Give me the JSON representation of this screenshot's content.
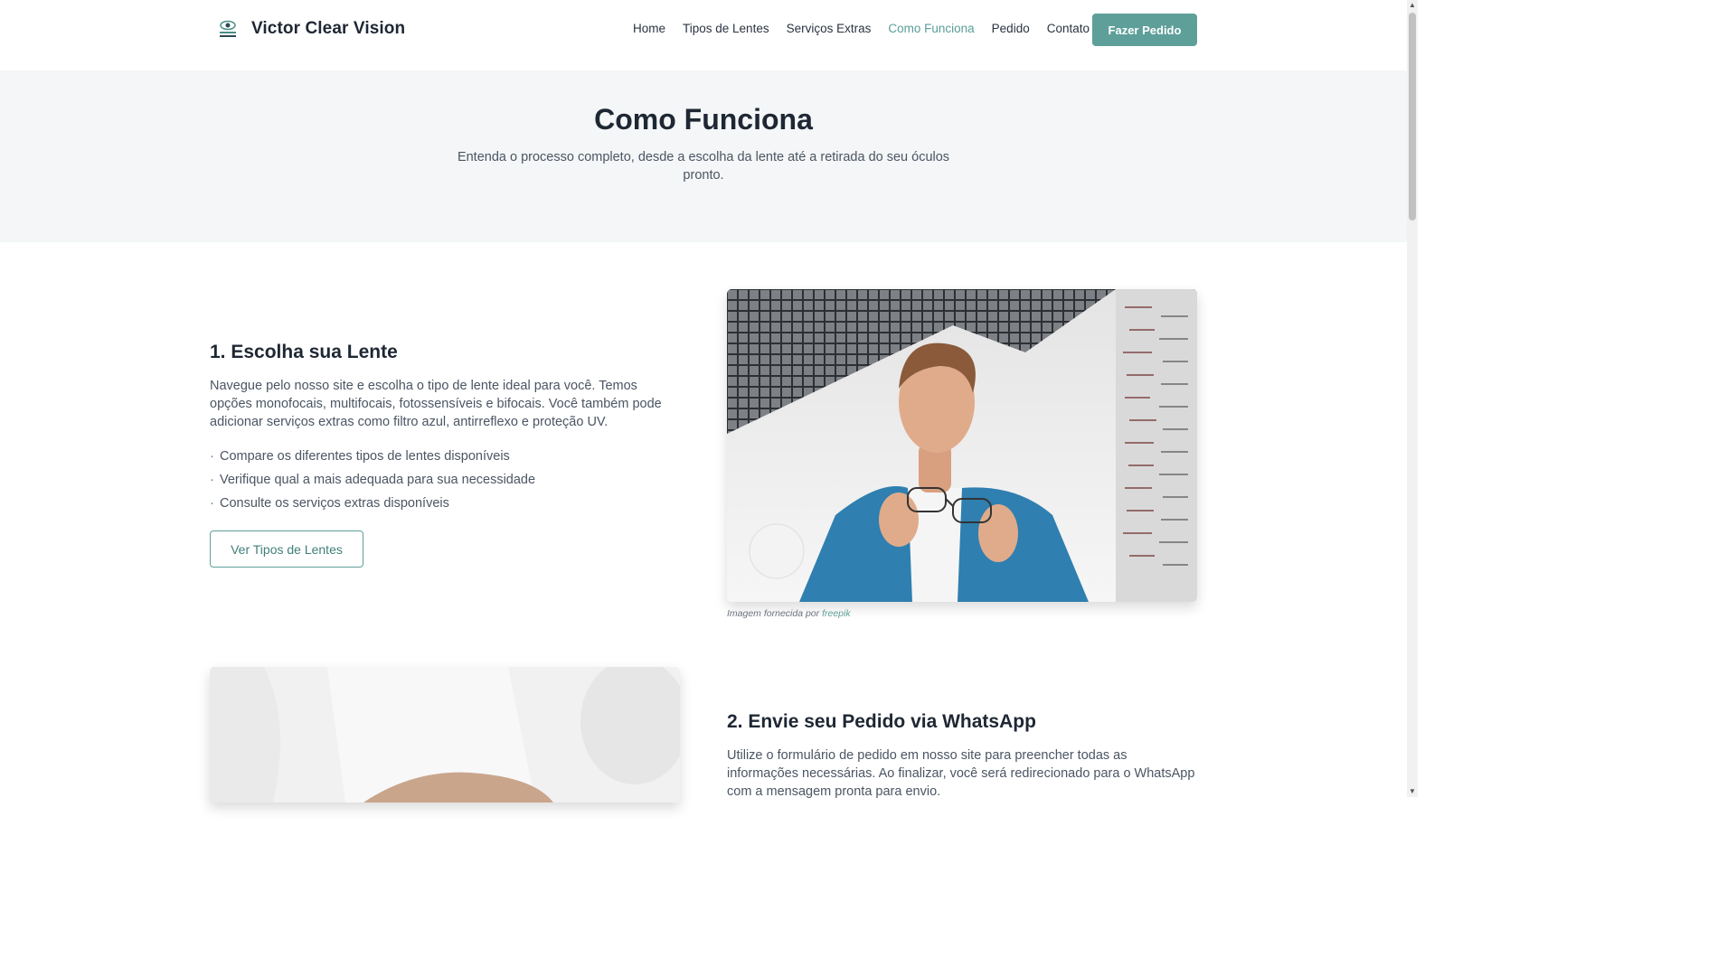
{
  "brand": {
    "name": "Victor Clear Vision",
    "logo_icon": "eye-logo-icon"
  },
  "nav": {
    "items": [
      {
        "label": "Home",
        "active": false
      },
      {
        "label": "Tipos de Lentes",
        "active": false
      },
      {
        "label": "Serviços Extras",
        "active": false
      },
      {
        "label": "Como Funciona",
        "active": true
      },
      {
        "label": "Pedido",
        "active": false
      },
      {
        "label": "Contato",
        "active": false
      }
    ],
    "cta_label": "Fazer Pedido"
  },
  "hero": {
    "title": "Como Funciona",
    "subtitle": "Entenda o processo completo, desde a escolha da lente até a retirada do seu óculos pronto."
  },
  "step1": {
    "title": "1. Escolha sua Lente",
    "text": "Navegue pelo nosso site e escolha o tipo de lente ideal para você. Temos opções monofocais, multifocais, fotossensíveis e bifocais. Você também pode adicionar serviços extras como filtro azul, antirreflexo e proteção UV.",
    "bullets": [
      "Compare os diferentes tipos de lentes disponíveis",
      "Verifique qual a mais adequada para sua necessidade",
      "Consulte os serviços extras disponíveis"
    ],
    "button_label": "Ver Tipos de Lentes",
    "caption_prefix": "Imagem fornecida por",
    "caption_link": "freepik"
  },
  "step2": {
    "title": "2. Envie seu Pedido via WhatsApp",
    "text": "Utilize o formulário de pedido em nosso site para preencher todas as informações necessárias. Ao finalizar, você será redirecionado para o WhatsApp com a mensagem pronta para envio."
  },
  "colors": {
    "accent": "#5e9f99",
    "heading": "#1e2733",
    "hero_bg": "#f4f6f7"
  }
}
